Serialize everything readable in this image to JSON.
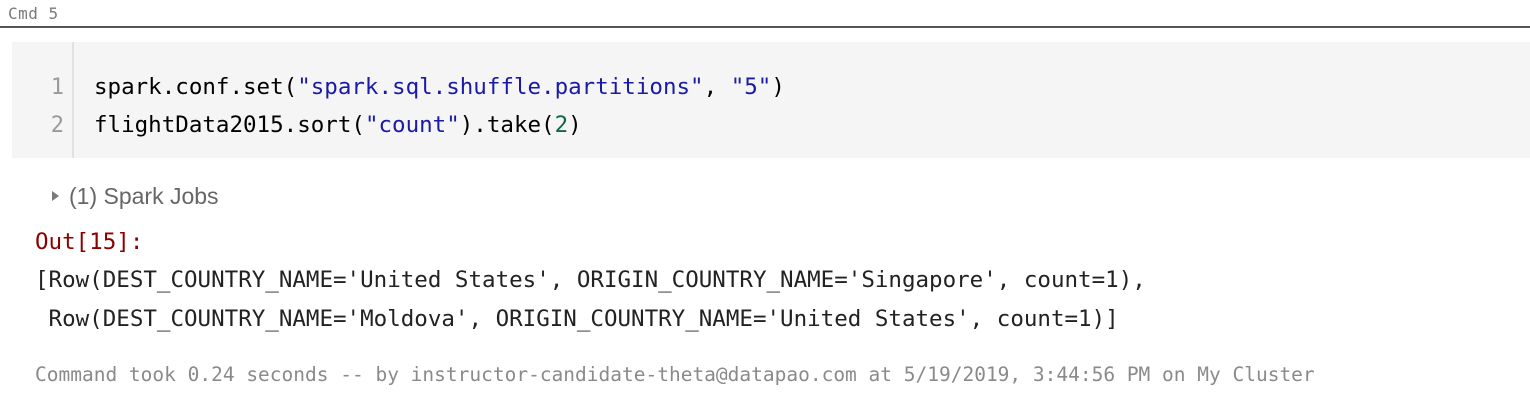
{
  "cell": {
    "command_label": "Cmd 5"
  },
  "code": {
    "lines": [
      {
        "number": "1",
        "parts": [
          {
            "text": "spark.conf.set(",
            "kind": "plain"
          },
          {
            "text": "\"spark.sql.shuffle.partitions\"",
            "kind": "string"
          },
          {
            "text": ", ",
            "kind": "plain"
          },
          {
            "text": "\"5\"",
            "kind": "string"
          },
          {
            "text": ")",
            "kind": "plain"
          }
        ]
      },
      {
        "number": "2",
        "parts": [
          {
            "text": "flightData2015.sort(",
            "kind": "plain"
          },
          {
            "text": "\"count\"",
            "kind": "string"
          },
          {
            "text": ").take(",
            "kind": "plain"
          },
          {
            "text": "2",
            "kind": "number"
          },
          {
            "text": ")",
            "kind": "plain"
          }
        ]
      }
    ]
  },
  "jobs": {
    "label": "(1) Spark Jobs"
  },
  "output": {
    "label": "Out[15]:",
    "lines": [
      "[Row(DEST_COUNTRY_NAME='United States', ORIGIN_COUNTRY_NAME='Singapore', count=1),",
      " Row(DEST_COUNTRY_NAME='Moldova', ORIGIN_COUNTRY_NAME='United States', count=1)]"
    ]
  },
  "footer": {
    "text": "Command took 0.24 seconds -- by instructor-candidate-theta@datapao.com at 5/19/2019, 3:44:56 PM on My Cluster"
  },
  "colors": {
    "string": "#1a1aa6",
    "number": "#116644",
    "out_label": "#8b0000",
    "code_background": "#f5f5f5"
  },
  "icons": {
    "jobs_toggle": "caret-right-icon"
  }
}
